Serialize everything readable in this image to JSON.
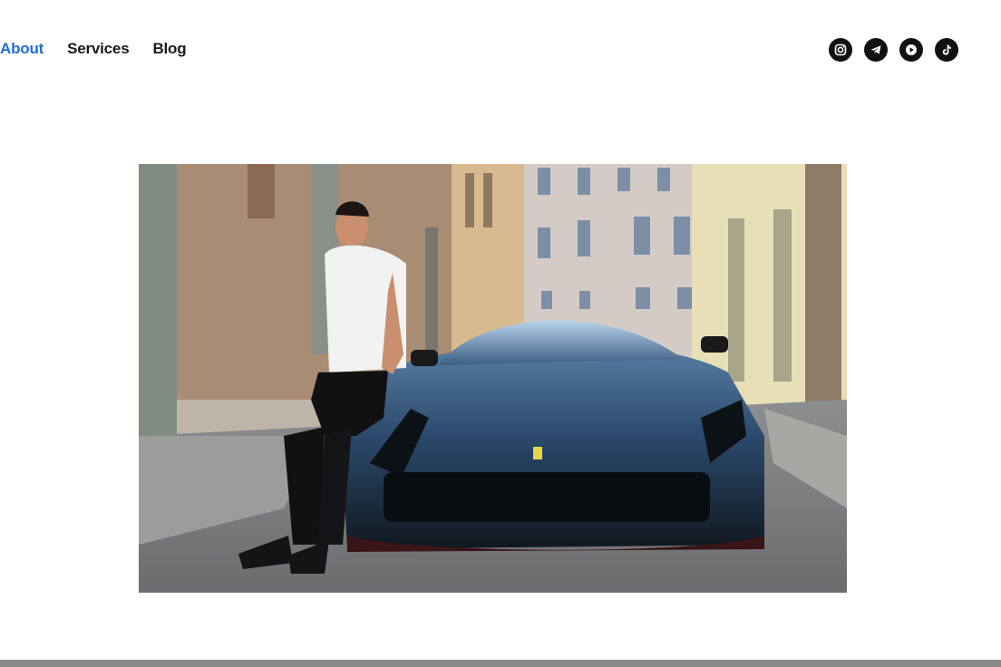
{
  "nav": {
    "items": [
      {
        "label": "About",
        "active": true
      },
      {
        "label": "Services",
        "active": false
      },
      {
        "label": "Blog",
        "active": false
      }
    ]
  },
  "social": {
    "icons": [
      "instagram-icon",
      "telegram-icon",
      "youtube-icon",
      "tiktok-icon"
    ]
  },
  "hero": {
    "image": "man-in-white-tshirt-sitting-on-black-sports-car-in-city-street"
  },
  "colors": {
    "active_link": "#1f6fd6",
    "nav_text": "#1a1a1a",
    "icon_bg": "#111111",
    "footer_bar": "#8a8a8a"
  }
}
